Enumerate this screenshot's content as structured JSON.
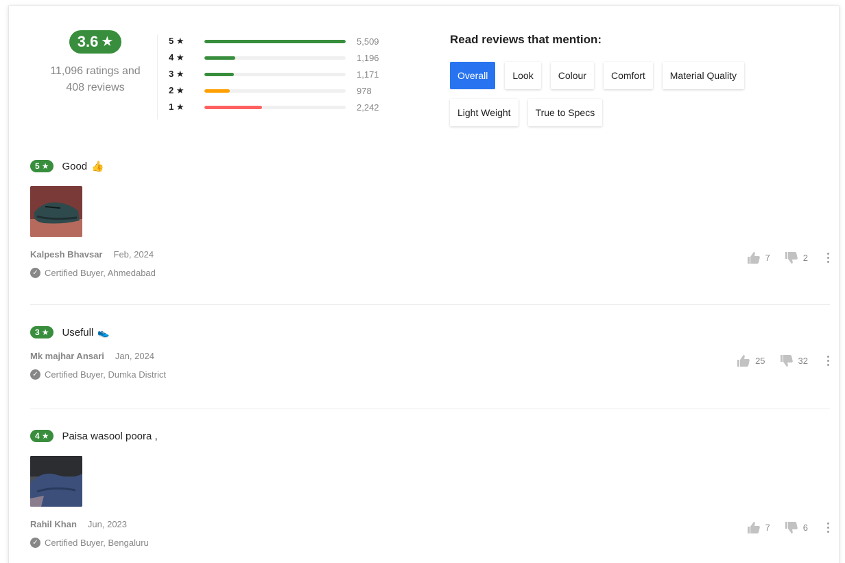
{
  "summary": {
    "rating": "3.6",
    "ratings_line": "11,096 ratings and",
    "reviews_line": "408 reviews"
  },
  "distribution": [
    {
      "label": "5",
      "count": "5,509",
      "fraction": 1.0,
      "color": "#388e3c"
    },
    {
      "label": "4",
      "count": "1,196",
      "fraction": 0.22,
      "color": "#388e3c"
    },
    {
      "label": "3",
      "count": "1,171",
      "fraction": 0.21,
      "color": "#388e3c"
    },
    {
      "label": "2",
      "count": "978",
      "fraction": 0.18,
      "color": "#ff9f00"
    },
    {
      "label": "1",
      "count": "2,242",
      "fraction": 0.41,
      "color": "#ff6161"
    }
  ],
  "mentions": {
    "title": "Read reviews that mention:",
    "chips": [
      "Overall",
      "Look",
      "Colour",
      "Comfort",
      "Material Quality",
      "Light Weight",
      "True to Specs"
    ],
    "active": "Overall"
  },
  "reviews": [
    {
      "rating": "5",
      "title": "Good",
      "emoji": "👍",
      "name": "Kalpesh Bhavsar",
      "date": "Feb, 2024",
      "location": "Certified Buyer, Ahmedabad",
      "likes": "7",
      "dislikes": "2"
    },
    {
      "rating": "3",
      "title": "Usefull",
      "emoji": "👟",
      "name": "Mk majhar Ansari",
      "date": "Jan, 2024",
      "location": "Certified Buyer, Dumka District",
      "likes": "25",
      "dislikes": "32"
    },
    {
      "rating": "4",
      "title": "Paisa wasool poora ,",
      "emoji": "",
      "name": "Rahil Khan",
      "date": "Jun, 2023",
      "location": "Certified Buyer, Bengaluru",
      "likes": "7",
      "dislikes": "6"
    }
  ],
  "colors": {
    "rating_green": "#388e3c",
    "primary_blue": "#2874f0"
  }
}
